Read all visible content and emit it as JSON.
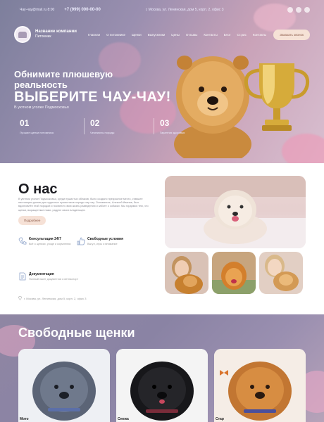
{
  "topbar": {
    "email": "Чау-чау@mail.ru 8:00",
    "phone": "+7 (999) 000-00-00",
    "address": "г. Москва, ул. Ленинская, дом 5, корп. 2, офис 3"
  },
  "nav": {
    "brand_name": "Название компании",
    "brand_tagline": "Питомник",
    "items": [
      "Главная",
      "О питомнике",
      "Щенки",
      "Выпускники",
      "Цены",
      "Отзывы",
      "Контакты",
      "Блог",
      "Ст.рис",
      "Контакты"
    ],
    "call_button": "Заказать звонок"
  },
  "hero": {
    "title_line1": "Обнимите плюшевую реальность",
    "title_line2": "ВЫБЕРИТЕ ЧАУ-ЧАУ!",
    "subtitle": "В уютном уголке Подмосковья",
    "stats": [
      {
        "num": "01",
        "text": "Лучшие щенки питомника"
      },
      {
        "num": "02",
        "text": "Чемпионы породы"
      },
      {
        "num": "03",
        "text": "Гарантия здоровья"
      }
    ]
  },
  "about": {
    "title": "О нас",
    "text": "В уютном уголке Подмосковья, среди пушистых облаков, было создано прекрасное место, ставшее настоящим домом для чудесных пушистиков породы чау-чау. Основатель, Алексей Иванов, был вдохновлён этой породой и посвятил свою жизнь разведению и заботе о собаках. Мы гордимся тем, что щенки, выращенные нами, радуют своих владельцев.",
    "more_button": "Подробнее",
    "features": [
      {
        "title": "Консультация 24/7",
        "text": "Всё о щенках, уходе и кормлении"
      },
      {
        "title": "Свободные условия",
        "text": "Выгул, игры и внимание"
      },
      {
        "title": "Документация",
        "text": "Полный пакет документов и ветпаспорт"
      }
    ],
    "address": "г. Москва, ул. Ленинская, дом 5, корп. 2, офис 3"
  },
  "puppies": {
    "title": "Свободные щенки",
    "cards": [
      {
        "name": "Мото"
      },
      {
        "name": "Снежа"
      },
      {
        "name": "Стар"
      }
    ]
  },
  "colors": {
    "accent": "#f6e1d6",
    "accent_text": "#8b5a48",
    "hero_bg": "#9a8fb0"
  }
}
